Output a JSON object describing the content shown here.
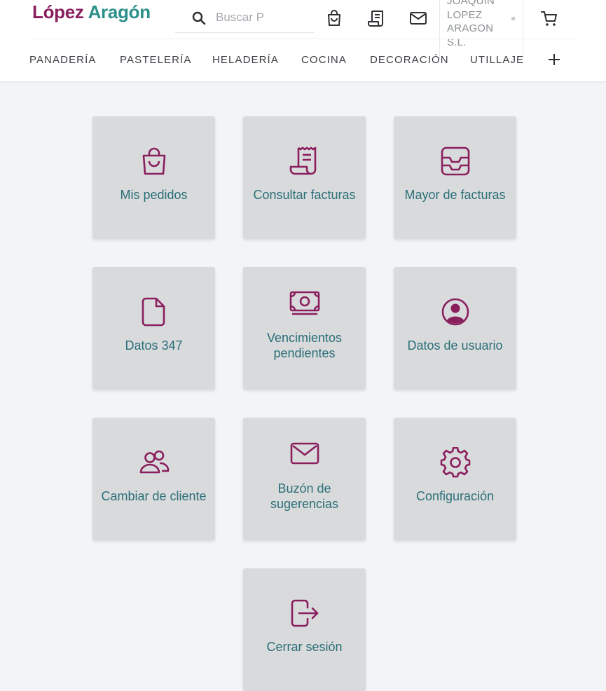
{
  "brand": {
    "logo_part1": "López",
    "logo_part2": "Aragón",
    "primary_color": "#8a1f5e",
    "secondary_color": "#2b8f8a"
  },
  "search": {
    "placeholder": "Buscar P",
    "value": ""
  },
  "header_icons": [
    "shopping-bag-icon",
    "receipt-icon",
    "mail-icon",
    "cart-icon"
  ],
  "account": {
    "name": "JOAQUIN LOPEZ ARAGON S.L."
  },
  "nav": {
    "items": [
      "PANADERÍA",
      "PASTELERÍA",
      "HELADERÍA",
      "COCINA",
      "DECORACIÓN",
      "UTILLAJE"
    ],
    "more_icon": "plus-icon"
  },
  "menu": {
    "cards": [
      {
        "label": "Mis pedidos",
        "icon": "shopping-bag-icon"
      },
      {
        "label": "Consultar facturas",
        "icon": "receipt-icon"
      },
      {
        "label": "Mayor de facturas",
        "icon": "inbox-tray-icon"
      },
      {
        "label": "Datos 347",
        "icon": "document-icon"
      },
      {
        "label": "Vencimientos pendientes",
        "icon": "banknote-icon"
      },
      {
        "label": "Datos de usuario",
        "icon": "user-circle-icon"
      },
      {
        "label": "Cambiar de cliente",
        "icon": "users-icon"
      },
      {
        "label": "Buzón de sugerencias",
        "icon": "mail-icon"
      },
      {
        "label": "Configuración",
        "icon": "gear-icon"
      },
      {
        "label": "Cerrar sesión",
        "icon": "logout-icon"
      }
    ]
  },
  "colors": {
    "card_bg": "#d9dadc",
    "card_label": "#2a6f78",
    "icon_color": "#8a1f5e",
    "page_bg": "#f2f4f7"
  }
}
